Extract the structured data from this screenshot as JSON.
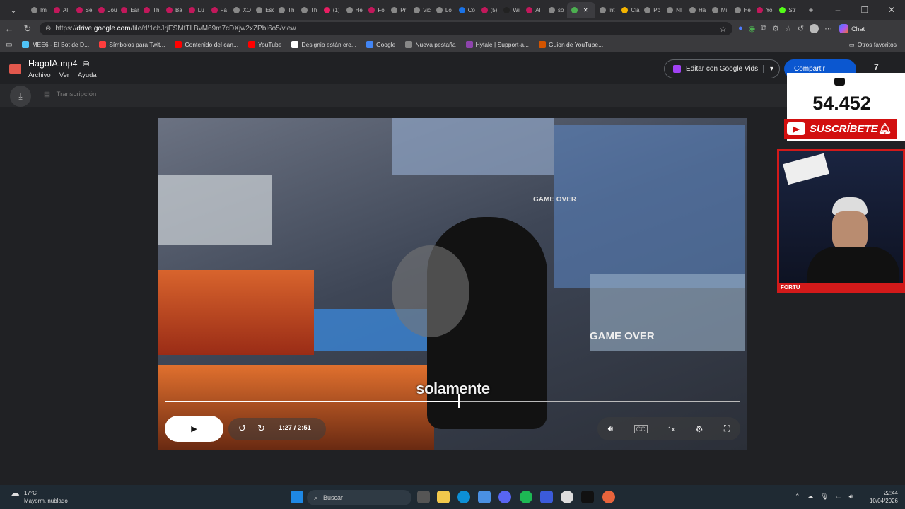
{
  "browser": {
    "tabs": [
      {
        "label": "Im",
        "color": "#888888"
      },
      {
        "label": "AI",
        "color": "#c2185b"
      },
      {
        "label": "Sel",
        "color": "#c2185b"
      },
      {
        "label": "Jou",
        "color": "#c2185b"
      },
      {
        "label": "Ear",
        "color": "#c2185b"
      },
      {
        "label": "Th",
        "color": "#c2185b"
      },
      {
        "label": "Ba",
        "color": "#c2185b"
      },
      {
        "label": "Lu",
        "color": "#c2185b"
      },
      {
        "label": "Fa",
        "color": "#c2185b"
      },
      {
        "label": "XO",
        "color": "#888888"
      },
      {
        "label": "Esc",
        "color": "#888888"
      },
      {
        "label": "Th",
        "color": "#888888"
      },
      {
        "label": "Th",
        "color": "#888888"
      },
      {
        "label": "(1)",
        "color": "#e91e63"
      },
      {
        "label": "He",
        "color": "#888888"
      },
      {
        "label": "Fo",
        "color": "#c2185b"
      },
      {
        "label": "Pr",
        "color": "#888888"
      },
      {
        "label": "Vic",
        "color": "#888888"
      },
      {
        "label": "Lo",
        "color": "#888888"
      },
      {
        "label": "Co",
        "color": "#1a73e8"
      },
      {
        "label": "(5)",
        "color": "#c2185b"
      },
      {
        "label": "Wi",
        "color": "#222222"
      },
      {
        "label": "AI",
        "color": "#c2185b"
      },
      {
        "label": "so",
        "color": "#888888"
      },
      {
        "label": "",
        "color": "#4caf50",
        "active": true
      },
      {
        "label": "Int",
        "color": "#888888"
      },
      {
        "label": "Cla",
        "color": "#f4b400"
      },
      {
        "label": "Po",
        "color": "#888888"
      },
      {
        "label": "NI",
        "color": "#888888"
      },
      {
        "label": "Ha",
        "color": "#888888"
      },
      {
        "label": "Mi",
        "color": "#888888"
      },
      {
        "label": "He",
        "color": "#888888"
      },
      {
        "label": "Yo",
        "color": "#c2185b"
      },
      {
        "label": "Str",
        "color": "#53fc18"
      }
    ],
    "url_prefix": "https://",
    "url_host": "drive.google.com",
    "url_path": "/file/d/1cbJrjESMtTLBvM69m7cDXjw2xZPbI6o5/view",
    "chat_label": "Chat",
    "bookmarks": [
      {
        "label": "MEE6 - El Bot de D...",
        "color": "#4fc3f7"
      },
      {
        "label": "Símbolos para Twit...",
        "color": "#ff3d3d"
      },
      {
        "label": "Contenido del can...",
        "color": "#ff0000"
      },
      {
        "label": "YouTube",
        "color": "#ff0000"
      },
      {
        "label": "Designio están cre...",
        "color": "#ffffff"
      },
      {
        "label": "Google",
        "color": "#4285f4"
      },
      {
        "label": "Nueva pestaña",
        "color": "#888888"
      },
      {
        "label": "Hytale | Support-a...",
        "color": "#8e44ad"
      },
      {
        "label": "Guion de YouTube...",
        "color": "#d35400"
      }
    ],
    "other_bookmarks": "Otros favoritos"
  },
  "drive": {
    "file_title": "HagoIA.mp4",
    "menus": [
      "Archivo",
      "Ver",
      "Ayuda"
    ],
    "edit_button": "Editar con Google Vids",
    "share_button": "Compartir",
    "transcription": "Transcripción"
  },
  "video": {
    "subtitle": "solamente",
    "current_time": "1:27",
    "duration": "2:51",
    "time_display": "1:27  / 2:51",
    "progress": 0.509,
    "speed": "1x",
    "overlay_text_1": "GAME OVER",
    "overlay_text_2": "GAME OVER"
  },
  "stream_overlay": {
    "sub_count": "54.452",
    "subscribe": "SUSCRÍBETE",
    "cam_name": "FORTU"
  },
  "taskbar": {
    "temp": "17°C",
    "weather": "Mayorm. nublado",
    "search": "Buscar",
    "time": "22:44",
    "date": "10/04/2026"
  }
}
